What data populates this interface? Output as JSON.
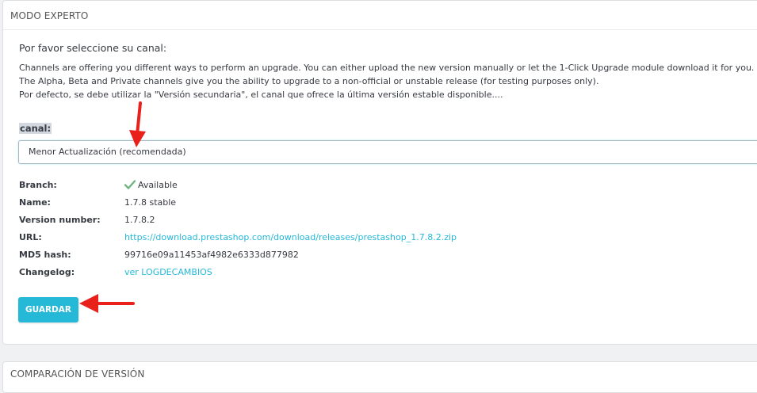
{
  "panels": {
    "expert_title": "MODO EXPERTO",
    "compare_title": "COMPARACIÓN DE VERSIÓN"
  },
  "channel_section": {
    "subtitle": "Por favor seleccione su canal:",
    "description_lines": [
      "Channels are offering you different ways to perform an upgrade. You can either upload the new version manually or let the 1-Click Upgrade module download it for you.",
      "The Alpha, Beta and Private channels give you the ability to upgrade to a non-official or unstable release (for testing purposes only).",
      "Por defecto, se debe utilizar la \"Versión secundaria\", el canal que ofrece la última versión estable disponible...."
    ],
    "channel_label": "canal:",
    "channel_selected": "Menor Actualización (recomendada)"
  },
  "info": {
    "branch_label": "Branch:",
    "branch_value": "Available",
    "name_label": "Name:",
    "name_value": "1.7.8 stable",
    "version_label": "Version number:",
    "version_value": "1.7.8.2",
    "url_label": "URL:",
    "url_value": "https://download.prestashop.com/download/releases/prestashop_1.7.8.2.zip",
    "md5_label": "MD5 hash:",
    "md5_value": "99716e09a11453af4982e6333d877982",
    "changelog_label": "Changelog:",
    "changelog_value": "ver LOGDECAMBIOS"
  },
  "actions": {
    "save_label": "GUARDAR"
  },
  "icons": {
    "branch_status": "checkmark-icon",
    "annotation": "red-arrow-icon"
  },
  "colors": {
    "accent": "#25b9d7",
    "check": "#70b580",
    "annotation_arrow": "#e8221b"
  }
}
